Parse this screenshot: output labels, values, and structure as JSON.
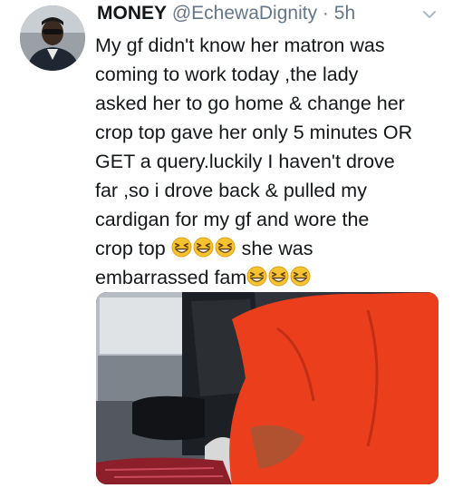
{
  "tweet": {
    "display_name": "MONEY",
    "handle": "@EchewaDignity",
    "separator": "·",
    "timestamp": "5h",
    "lines": [
      "My gf didn't know her matron was",
      "coming to work today ,the lady",
      "asked her to go home & change her",
      "crop top gave her only 5 minutes OR",
      "GET a query.luckily I haven't drove",
      "far ,so i drove back & pulled my",
      "cardigan for my gf and wore the"
    ],
    "line8_before": "crop top ",
    "line8_after": " she was",
    "line9_before": "embarrassed fam",
    "emoji_name": "grinning-squinting-face-icon"
  },
  "colors": {
    "text": "#14171a",
    "secondary": "#657786",
    "emoji_yellow": "#f7c230",
    "shirt_orange": "#ea3e1d"
  }
}
